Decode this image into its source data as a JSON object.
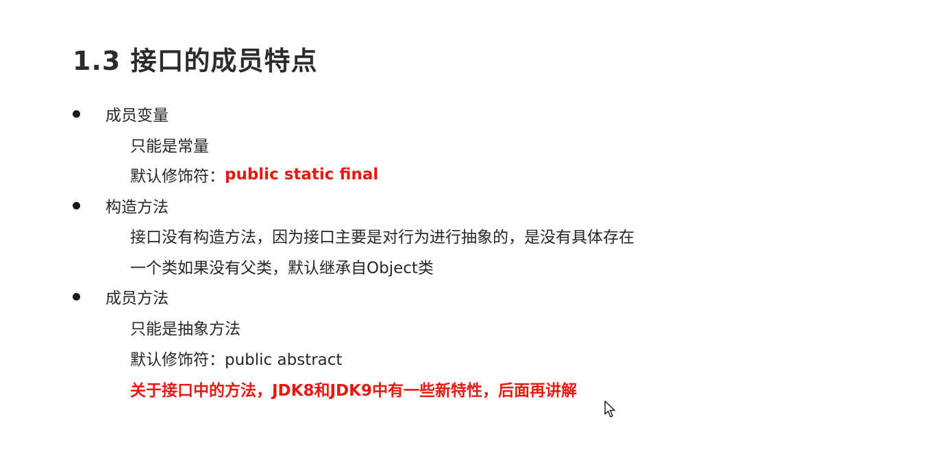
{
  "slide": {
    "title": "1.3 接口的成员特点",
    "sections": [
      {
        "heading": "成员变量",
        "lines": [
          {
            "text": "只能是常量"
          },
          {
            "label": "默认修饰符：",
            "highlight": "public static final"
          }
        ]
      },
      {
        "heading": "构造方法",
        "lines": [
          {
            "text": "接口没有构造方法，因为接口主要是对行为进行抽象的，是没有具体存在"
          },
          {
            "text": "一个类如果没有父类，默认继承自Object类"
          }
        ]
      },
      {
        "heading": "成员方法",
        "lines": [
          {
            "text": "只能是抽象方法"
          },
          {
            "text": "默认修饰符：public abstract"
          },
          {
            "highlight": "关于接口中的方法，JDK8和JDK9中有一些新特性，后面再讲解"
          }
        ]
      }
    ]
  },
  "colors": {
    "accent_red": "#e8170f",
    "text": "#262626",
    "background": "#ffffff"
  },
  "icons": {
    "cursor": "arrow-pointer-icon"
  }
}
